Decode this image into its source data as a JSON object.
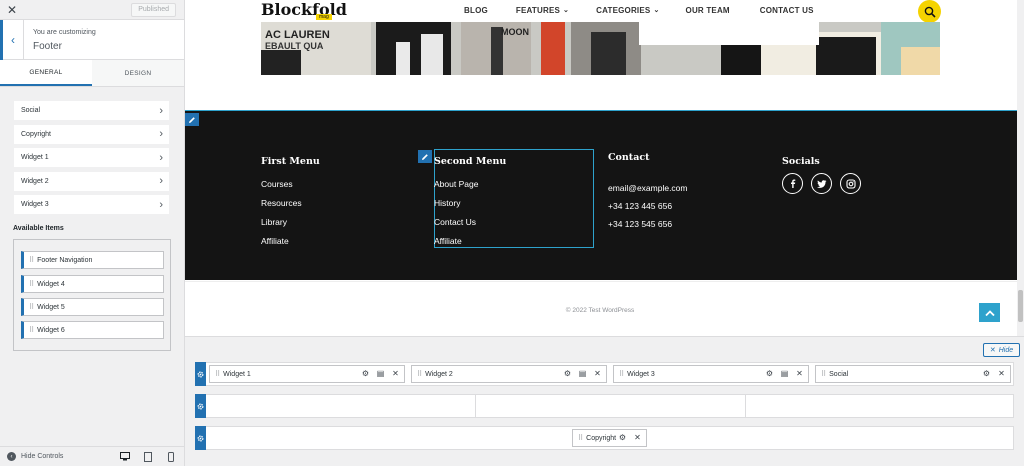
{
  "sidebar": {
    "close_icon": "close-icon",
    "published_label": "Published",
    "customizing_label": "You are customizing",
    "section_title": "Footer",
    "tabs": [
      {
        "label": "GENERAL"
      },
      {
        "label": "DESIGN"
      }
    ],
    "items": [
      {
        "label": "Social"
      },
      {
        "label": "Copyright"
      },
      {
        "label": "Widget 1"
      },
      {
        "label": "Widget 2"
      },
      {
        "label": "Widget 3"
      }
    ],
    "available_title": "Available Items",
    "available_items": [
      {
        "label": "Footer Navigation"
      },
      {
        "label": "Widget 4"
      },
      {
        "label": "Widget 5"
      },
      {
        "label": "Widget 6"
      }
    ],
    "hide_controls_label": "Hide Controls"
  },
  "header": {
    "logo": "Blockfold",
    "logo_badge": "mag",
    "nav": [
      {
        "label": "BLOG"
      },
      {
        "label": "FEATURES"
      },
      {
        "label": "CATEGORIES"
      },
      {
        "label": "OUR TEAM"
      },
      {
        "label": "CONTACT US"
      }
    ]
  },
  "footer": {
    "first_menu": {
      "title": "First Menu",
      "links": [
        "Courses",
        "Resources",
        "Library",
        "Affiliate"
      ]
    },
    "second_menu": {
      "title": "Second Menu",
      "links": [
        "About Page",
        "History",
        "Contact Us",
        "Affiliate"
      ]
    },
    "contact": {
      "title": "Contact",
      "lines": [
        "email@example.com",
        "+34 123 445 656",
        "+34 123 545 656"
      ]
    },
    "socials": {
      "title": "Socials",
      "icons": [
        "facebook-icon",
        "twitter-icon",
        "instagram-icon"
      ]
    },
    "copyright": "© 2022 Test WordPress"
  },
  "builder": {
    "hide_label": "Hide",
    "row1": [
      {
        "label": "Widget 1"
      },
      {
        "label": "Widget 2"
      },
      {
        "label": "Widget 3"
      },
      {
        "label": "Social"
      }
    ],
    "row3": [
      {
        "label": "Copyright"
      }
    ]
  },
  "colors": {
    "accent": "#2271b1",
    "highlight": "#2ea2cc",
    "footer_bg": "#141414",
    "brand_yellow": "#f5d300"
  }
}
